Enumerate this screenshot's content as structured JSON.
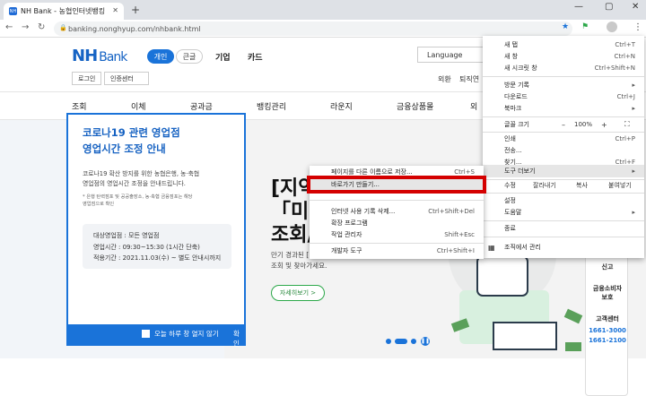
{
  "browser": {
    "tab_title": "NH Bank - 농협인터넷뱅킹",
    "tab_favicon": "NH",
    "new_tab": "+",
    "url": "banking.nonghyup.com/nhbank.html",
    "win_min": "—",
    "win_max": "▢",
    "win_close": "✕"
  },
  "header": {
    "logo_nh": "NH",
    "logo_bank": "Bank",
    "tab_personal": "개인",
    "tab_corporate": "큰글",
    "link_company": "기업",
    "link_card": "카드",
    "login": "로그인",
    "cert": "인증센터",
    "language": "Language",
    "top_links": [
      "외환",
      "퇴직연"
    ]
  },
  "gnb": [
    "조회",
    "이체",
    "공과금",
    "뱅킹관리",
    "라운지",
    "금융상품몰",
    "외"
  ],
  "popup": {
    "title_line1": "코로나19 관련 영업점",
    "title_line2": "영업시간 조정 안내",
    "body_line1": "코로나19 확산 방지를 위한 농협은행, 농·축협",
    "body_line2": "영업점의 영업시간 조정을 안내드립니다.",
    "note_line1": "* 은행 탄력점포 및 공공출장소, 농·축협 금융점포는 해당",
    "note_line2": "영업점으로 확인",
    "box_line1": "대상영업점 : 모든 영업점",
    "box_line2": "영업시간 : 09:30~15:30 (1시간 단축)",
    "box_line3": "적용기간 : 2021.11.03(수) ~ 별도 안내시까지",
    "dont_show": "오늘 하루 창 열지 않기",
    "confirm": "확인"
  },
  "hero": {
    "title_line1": "[지역",
    "title_line2": "「미싱",
    "title_line3": "조회/",
    "sub_line1": "만기 경과된 [",
    "sub_line2": "조회 및 찾아가세요.",
    "more": "자세히보기  >"
  },
  "sidebar": {
    "item1": "신고",
    "item2": "금융소비자",
    "item3": "보호",
    "item4": "고객센터",
    "phone1": "1661-3000",
    "phone2": "1661-2100"
  },
  "chrome_menu": {
    "new_tab": "새 탭",
    "new_tab_sc": "Ctrl+T",
    "new_window": "새 창",
    "new_window_sc": "Ctrl+N",
    "incognito": "새 시크릿 창",
    "incognito_sc": "Ctrl+Shift+N",
    "history": "방문 기록",
    "downloads": "다운로드",
    "downloads_sc": "Ctrl+J",
    "bookmarks": "북마크",
    "zoom": "글꼴 크기",
    "zoom_minus": "–",
    "zoom_value": "100%",
    "zoom_plus": "+",
    "fullscreen": "⛶",
    "print": "인쇄",
    "print_sc": "Ctrl+P",
    "cast": "전송...",
    "find": "찾기...",
    "find_sc": "Ctrl+F",
    "more_tools": "도구 더보기",
    "edit": "수정",
    "cut": "잘라내기",
    "copy": "복사",
    "paste": "붙여넣기",
    "settings": "설정",
    "help": "도움말",
    "exit": "종료",
    "managed": "조직에서 관리"
  },
  "submenu": {
    "save_page": "페이지를 다른 이름으로 저장...",
    "save_page_sc": "Ctrl+S",
    "create_shortcut": "바로가기 만들기...",
    "clear_data": "인터넷 사용 기록 삭제...",
    "clear_data_sc": "Ctrl+Shift+Del",
    "extensions": "확장 프로그램",
    "task_manager": "작업 관리자",
    "task_manager_sc": "Shift+Esc",
    "dev_tools": "개발자 도구",
    "dev_tools_sc": "Ctrl+Shift+I"
  },
  "colors": {
    "accent": "#1a73d9",
    "highlight": "#d40000",
    "brand_green": "#2ca84a"
  }
}
